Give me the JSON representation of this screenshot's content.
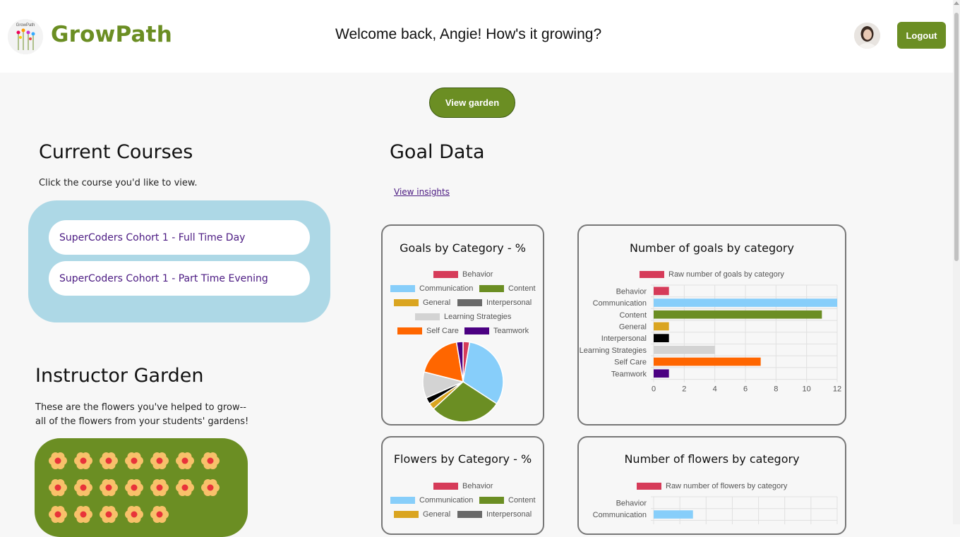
{
  "app": {
    "brand": "GrowPath",
    "welcome": "Welcome back, Angie! How's it growing?",
    "logout_label": "Logout",
    "view_garden_label": "View garden"
  },
  "courses": {
    "title": "Current Courses",
    "subtitle": "Click the course you'd like to view.",
    "items": [
      {
        "label": "SuperCoders Cohort 1 - Full Time Day"
      },
      {
        "label": "SuperCoders Cohort 1 - Part Time Evening"
      }
    ]
  },
  "goal_data": {
    "title": "Goal Data",
    "insights_link": "View insights"
  },
  "garden": {
    "title": "Instructor Garden",
    "line1": "These are the flowers you've helped to grow--",
    "line2": "all of the flowers from your students' gardens!",
    "flower_count": 19
  },
  "colors": {
    "Behavior": "#d63b59",
    "Communication": "#87cefa",
    "Content": "#6b8e23",
    "General": "#daa520",
    "Interpersonal_pie": "#000000",
    "Interpersonal_legend": "#696969",
    "Learning Strategies": "#d3d3d3",
    "Self Care": "#ff6600",
    "Teamwork": "#4b0082",
    "accent": "#6b8e23"
  },
  "chart_data": [
    {
      "type": "pie",
      "title": "Goals by Category - %",
      "categories": [
        "Behavior",
        "Communication",
        "Content",
        "General",
        "Interpersonal",
        "Learning Strategies",
        "Self Care",
        "Teamwork"
      ],
      "values": [
        1,
        12,
        11,
        1,
        1,
        4,
        7,
        1
      ],
      "legend": [
        "Behavior",
        "Communication",
        "Content",
        "General",
        "Interpersonal",
        "Learning Strategies",
        "Self Care",
        "Teamwork"
      ]
    },
    {
      "type": "bar",
      "orientation": "horizontal",
      "title": "Number of goals by category",
      "legend": [
        "Raw number of goals by category"
      ],
      "categories": [
        "Behavior",
        "Communication",
        "Content",
        "General",
        "Interpersonal",
        "Learning Strategies",
        "Self Care",
        "Teamwork"
      ],
      "values": [
        1,
        12,
        11,
        1,
        1,
        4,
        7,
        1
      ],
      "xlim": [
        0,
        12
      ],
      "xticks": [
        "0",
        "2",
        "4",
        "6",
        "8",
        "10",
        "12"
      ],
      "grid": true
    },
    {
      "type": "pie",
      "title": "Flowers by Category - %",
      "legend": [
        "Behavior",
        "Communication",
        "Content",
        "General",
        "Interpersonal"
      ]
    },
    {
      "type": "bar",
      "orientation": "horizontal",
      "title": "Number of flowers by category",
      "legend": [
        "Raw number of flowers by category"
      ],
      "categories": [
        "Behavior",
        "Communication"
      ],
      "values": [
        0,
        1.5
      ],
      "xlim": [
        0,
        7
      ],
      "grid": true
    }
  ]
}
